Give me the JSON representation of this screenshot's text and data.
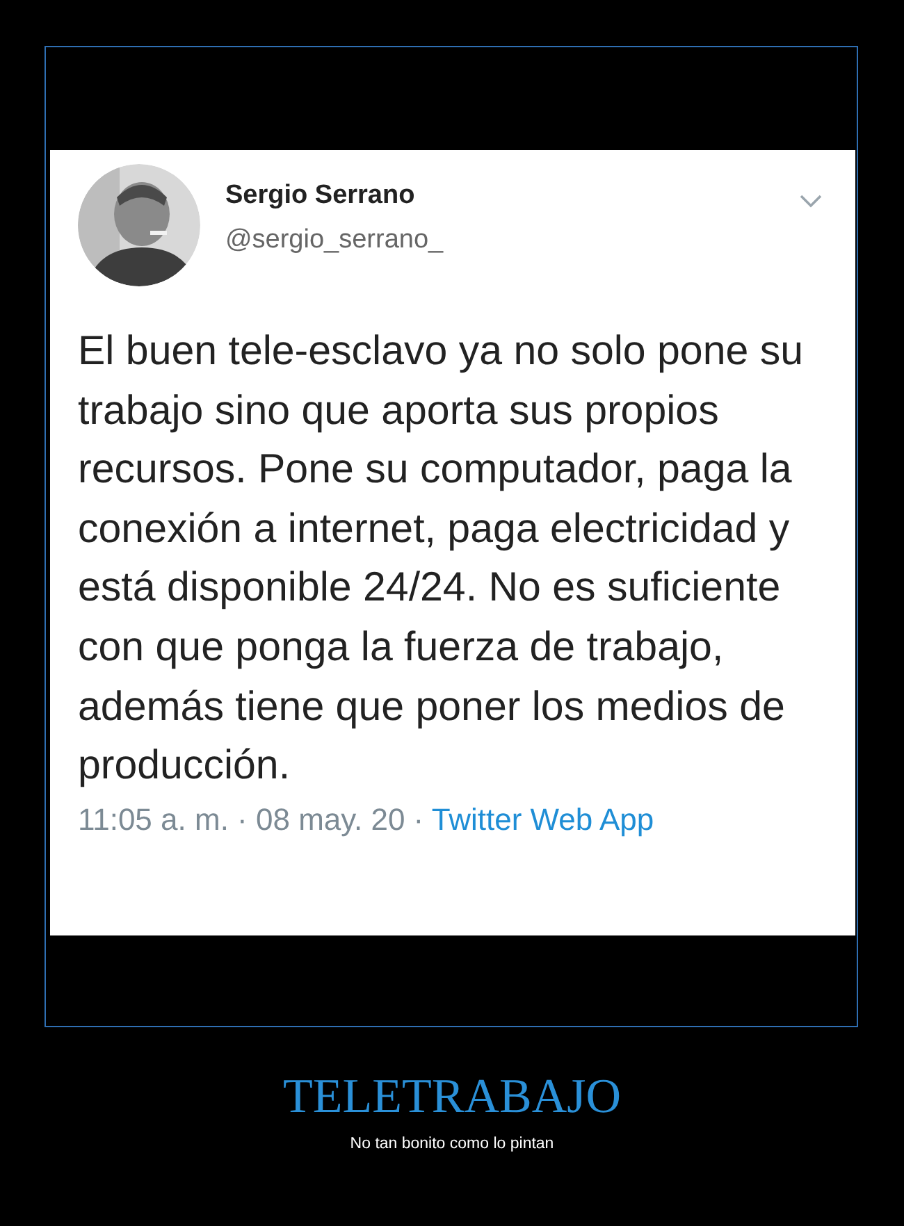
{
  "tweet": {
    "author": "Sergio Serrano",
    "handle": "@sergio_serrano_",
    "text": "El buen tele-esclavo ya no solo pone su trabajo sino que aporta sus propios recursos. Pone su computador, paga la conexión a internet, paga electricidad y está disponible 24/24. No es suficiente con que ponga la fuerza de trabajo, además tiene que poner los medios de producción.",
    "timestamp": "11:05 a. m. · 08 may. 20 ·",
    "source": "Twitter Web App"
  },
  "title": "TELETRABAJO",
  "subtitle": "No tan bonito como lo pintan"
}
